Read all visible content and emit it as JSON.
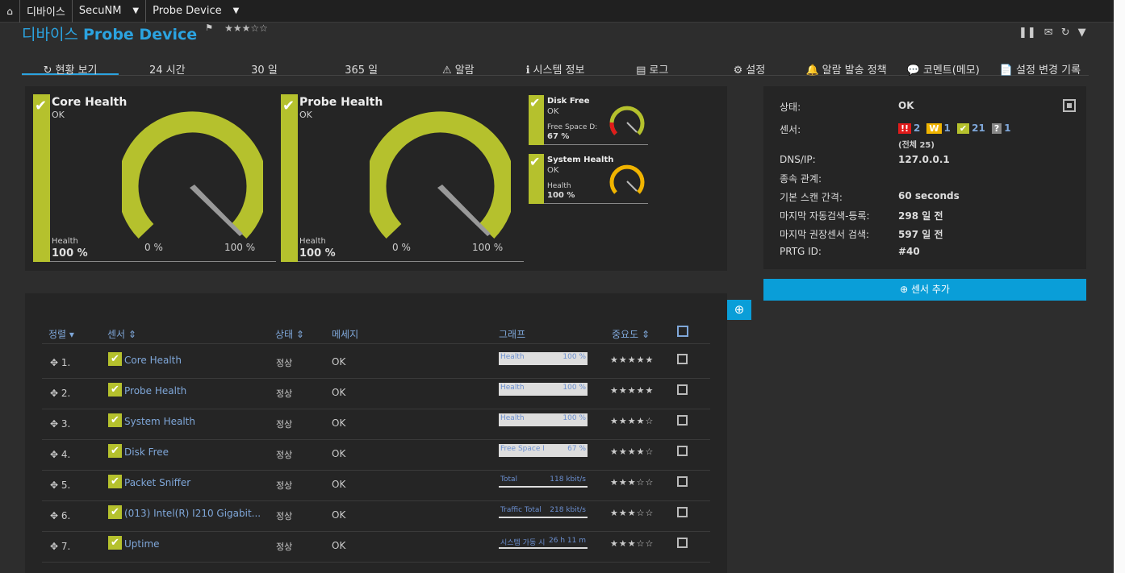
{
  "topbar": {
    "home_icon": "home-icon",
    "crumbs": [
      "디바이스",
      "SecuNM",
      "Probe Device"
    ]
  },
  "title": {
    "prefix": "디바이스",
    "name": "Probe Device",
    "stars": "★★★☆☆"
  },
  "tabs": [
    {
      "label": "현황 보기",
      "icon": "refresh-icon",
      "active": true
    },
    {
      "label": "24 시간",
      "icon": ""
    },
    {
      "label": "30 일",
      "icon": ""
    },
    {
      "label": "365 일",
      "icon": ""
    },
    {
      "label": "알람",
      "icon": "warning-icon"
    },
    {
      "label": "시스템 정보",
      "icon": "info-icon"
    },
    {
      "label": "로그",
      "icon": "log-icon"
    },
    {
      "label": "설정",
      "icon": "gear-icon"
    },
    {
      "label": "알람 발송 정책",
      "icon": "bell-icon"
    },
    {
      "label": "코멘트(메모)",
      "icon": "comment-icon"
    },
    {
      "label": "설정 변경 기록",
      "icon": "history-icon"
    }
  ],
  "gauges": {
    "core": {
      "name": "Core Health",
      "status": "OK",
      "label": "Health",
      "value": "100 %",
      "min": "0 %",
      "max": "100 %",
      "fraction": 1.0
    },
    "probe": {
      "name": "Probe Health",
      "status": "OK",
      "label": "Health",
      "value": "100 %",
      "min": "0 %",
      "max": "100 %",
      "fraction": 1.0
    },
    "disk": {
      "name": "Disk Free",
      "status": "OK",
      "label": "Free Space D:",
      "value": "67 %",
      "fraction": 0.67
    },
    "system": {
      "name": "System Health",
      "status": "OK",
      "label": "Health",
      "value": "100 %",
      "fraction": 1.0
    }
  },
  "info": {
    "status_label": "상태:",
    "status": "OK",
    "sensors_label": "센서:",
    "badges": [
      {
        "icon": "!!",
        "count": "2",
        "color": "#e01b1b"
      },
      {
        "icon": "W",
        "count": "1",
        "color": "#f0b400"
      },
      {
        "icon": "✔",
        "count": "21",
        "color": "#b5c12d"
      },
      {
        "icon": "?",
        "count": "1",
        "color": "#888888"
      }
    ],
    "sensors_total": "(전체 25)",
    "dns_label": "DNS/IP:",
    "dns": "127.0.0.1",
    "dep_label": "종속 관계:",
    "dep": "",
    "scan_label": "기본 스캔 간격:",
    "scan": "60 seconds",
    "auto_label": "마지막 자동검색-등록:",
    "auto": "298 일 전",
    "rec_label": "마지막 권장센서 검색:",
    "rec": "597 일 전",
    "prtg_label": "PRTG ID:",
    "prtg": "#40"
  },
  "add_sensor": "센서 추가",
  "list": {
    "headers": {
      "sort": "정렬",
      "sensor": "센서",
      "state": "상태",
      "message": "메세지",
      "graph": "그래프",
      "priority": "중요도"
    },
    "rows": [
      {
        "num": "1.",
        "name": "Core Health",
        "state": "정상",
        "message": "OK",
        "graph_label": "Health",
        "graph_value": "100 %",
        "prio": "★★★★★",
        "spark": false
      },
      {
        "num": "2.",
        "name": "Probe Health",
        "state": "정상",
        "message": "OK",
        "graph_label": "Health",
        "graph_value": "100 %",
        "prio": "★★★★★",
        "spark": false
      },
      {
        "num": "3.",
        "name": "System Health",
        "state": "정상",
        "message": "OK",
        "graph_label": "Health",
        "graph_value": "100 %",
        "prio": "★★★★☆",
        "spark": false
      },
      {
        "num": "4.",
        "name": "Disk Free",
        "state": "정상",
        "message": "OK",
        "graph_label": "Free Space I",
        "graph_value": "67 %",
        "prio": "★★★★☆",
        "spark": false
      },
      {
        "num": "5.",
        "name": "Packet Sniffer",
        "state": "정상",
        "message": "OK",
        "graph_label": "Total",
        "graph_value": "118 kbit/s",
        "prio": "★★★☆☆",
        "spark": true
      },
      {
        "num": "6.",
        "name": "(013) Intel(R) I210 Gigabit...",
        "state": "정상",
        "message": "OK",
        "graph_label": "Traffic Total",
        "graph_value": "218 kbit/s",
        "prio": "★★★☆☆",
        "spark": true
      },
      {
        "num": "7.",
        "name": "Uptime",
        "state": "정상",
        "message": "OK",
        "graph_label": "시스템 가동 시",
        "graph_value": "26 h 11 m",
        "prio": "★★★☆☆",
        "spark": true
      }
    ]
  },
  "colors": {
    "ok_green": "#b5c12d",
    "accent_blue": "#0a9ed8",
    "link_blue": "#2ba3e0"
  }
}
